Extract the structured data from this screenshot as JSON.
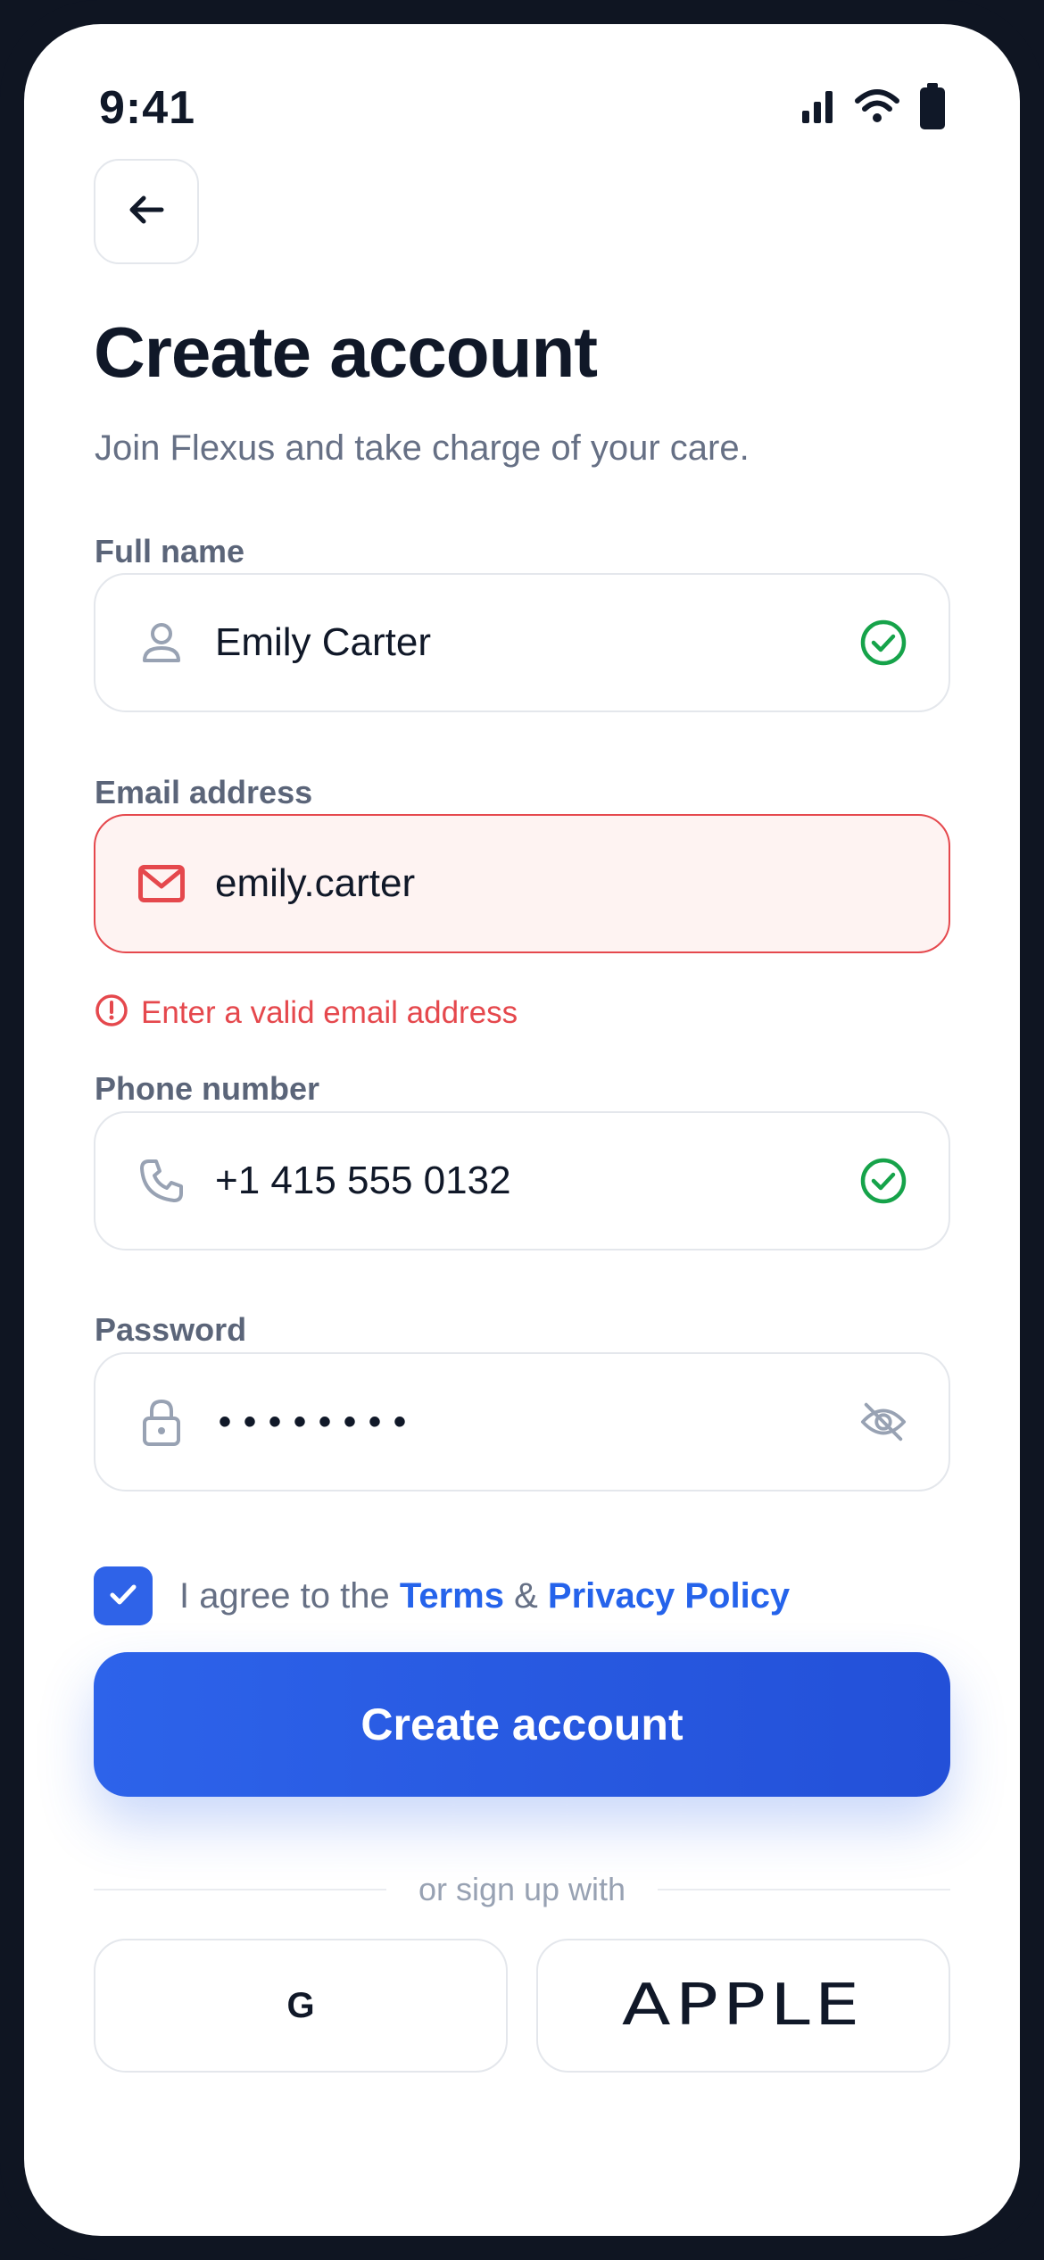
{
  "status_bar": {
    "time": "9:41"
  },
  "header": {
    "title": "Create account",
    "subtitle": "Join Flexus and take charge of your care."
  },
  "form": {
    "full_name": {
      "label": "Full name",
      "value": "Emily Carter",
      "state": "valid"
    },
    "email": {
      "label": "Email address",
      "value": "emily.carter",
      "state": "error",
      "error": "Enter a valid email address"
    },
    "phone": {
      "label": "Phone number",
      "value": "+1 415 555 0132",
      "state": "valid"
    },
    "password": {
      "label": "Password",
      "value": "••••••••"
    }
  },
  "agreement": {
    "checked": true,
    "prefix": "I agree to the",
    "terms": "Terms",
    "amp": "&",
    "privacy": "Privacy Policy"
  },
  "cta": {
    "label": "Create account"
  },
  "social": {
    "divider": "or sign up with",
    "google": "G",
    "apple": "APPLE"
  },
  "colors": {
    "accent": "#2f63e8",
    "error": "#e5484d",
    "success": "#16a34a",
    "text_primary": "#101828",
    "text_muted": "#667085"
  },
  "icons": {
    "back": "arrow-left-icon",
    "name": "user-icon",
    "email": "mail-icon",
    "phone": "phone-icon",
    "password": "lock-icon",
    "valid": "check-circle-icon",
    "error": "alert-circle-icon",
    "toggle": "eye-off-icon"
  }
}
